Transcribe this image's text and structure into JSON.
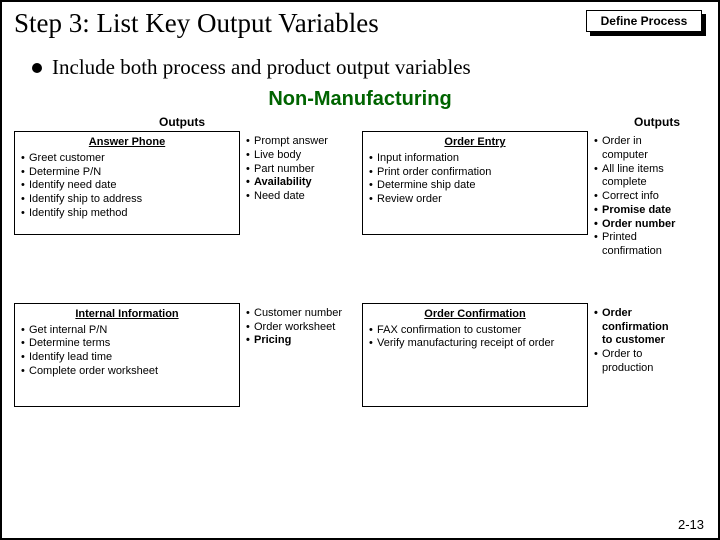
{
  "title": "Step 3:  List Key Output Variables",
  "badge": "Define Process",
  "subtitle": "Include both process and product output variables",
  "section_heading": "Non-Manufacturing",
  "col_left_head": "Outputs",
  "col_right_head": "Outputs",
  "panels": {
    "answer_phone": {
      "title": "Answer Phone",
      "items": [
        "Greet customer",
        "Determine P/N",
        "Identify need date",
        "Identify ship to address",
        "Identify ship method"
      ]
    },
    "answer_phone_outputs": [
      {
        "t": "Prompt answer"
      },
      {
        "t": "Live body"
      },
      {
        "t": "Part number"
      },
      {
        "t": "Availability",
        "b": true
      },
      {
        "t": "Need date"
      }
    ],
    "order_entry": {
      "title": "Order Entry",
      "items": [
        "Input information",
        "Print order confirmation",
        "Determine ship date",
        "Review order"
      ]
    },
    "order_entry_outputs": [
      {
        "t": "Order in computer"
      },
      {
        "t": "All line items complete"
      },
      {
        "t": "Correct info"
      },
      {
        "t": "Promise date",
        "b": true
      },
      {
        "t": "Order number",
        "b": true
      },
      {
        "t": "Printed confirmation"
      }
    ],
    "internal_info": {
      "title": "Internal Information",
      "items": [
        "Get internal P/N",
        "Determine terms",
        "Identify lead time",
        "Complete order worksheet"
      ]
    },
    "internal_info_outputs": [
      {
        "t": "Customer number"
      },
      {
        "t": "Order worksheet"
      },
      {
        "t": "Pricing",
        "b": true
      }
    ],
    "order_conf": {
      "title": "Order Confirmation",
      "items": [
        "FAX confirmation to customer",
        "Verify manufacturing receipt of order"
      ]
    },
    "order_conf_outputs": [
      {
        "t": "Order confirmation to customer",
        "b": true
      },
      {
        "t": "Order to production"
      }
    ]
  },
  "page_num": "2-13"
}
